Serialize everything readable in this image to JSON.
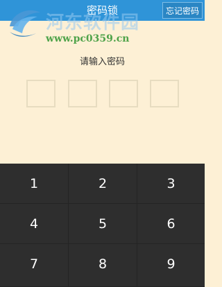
{
  "header": {
    "title": "密码锁",
    "forgot_label": "忘记密码"
  },
  "prompt": "请输入密码",
  "pin": {
    "length": 4,
    "entered": 0
  },
  "keypad": {
    "keys": [
      "1",
      "2",
      "3",
      "4",
      "5",
      "6",
      "7",
      "8",
      "9"
    ]
  },
  "watermark": {
    "site_name": "河东软件园",
    "url": "www.pc0359.cn"
  },
  "colors": {
    "header_bg": "#2f94d8",
    "body_bg": "#fdf0d5",
    "keypad_bg": "#2e2e2e",
    "watermark_url": "#4fa34a"
  }
}
